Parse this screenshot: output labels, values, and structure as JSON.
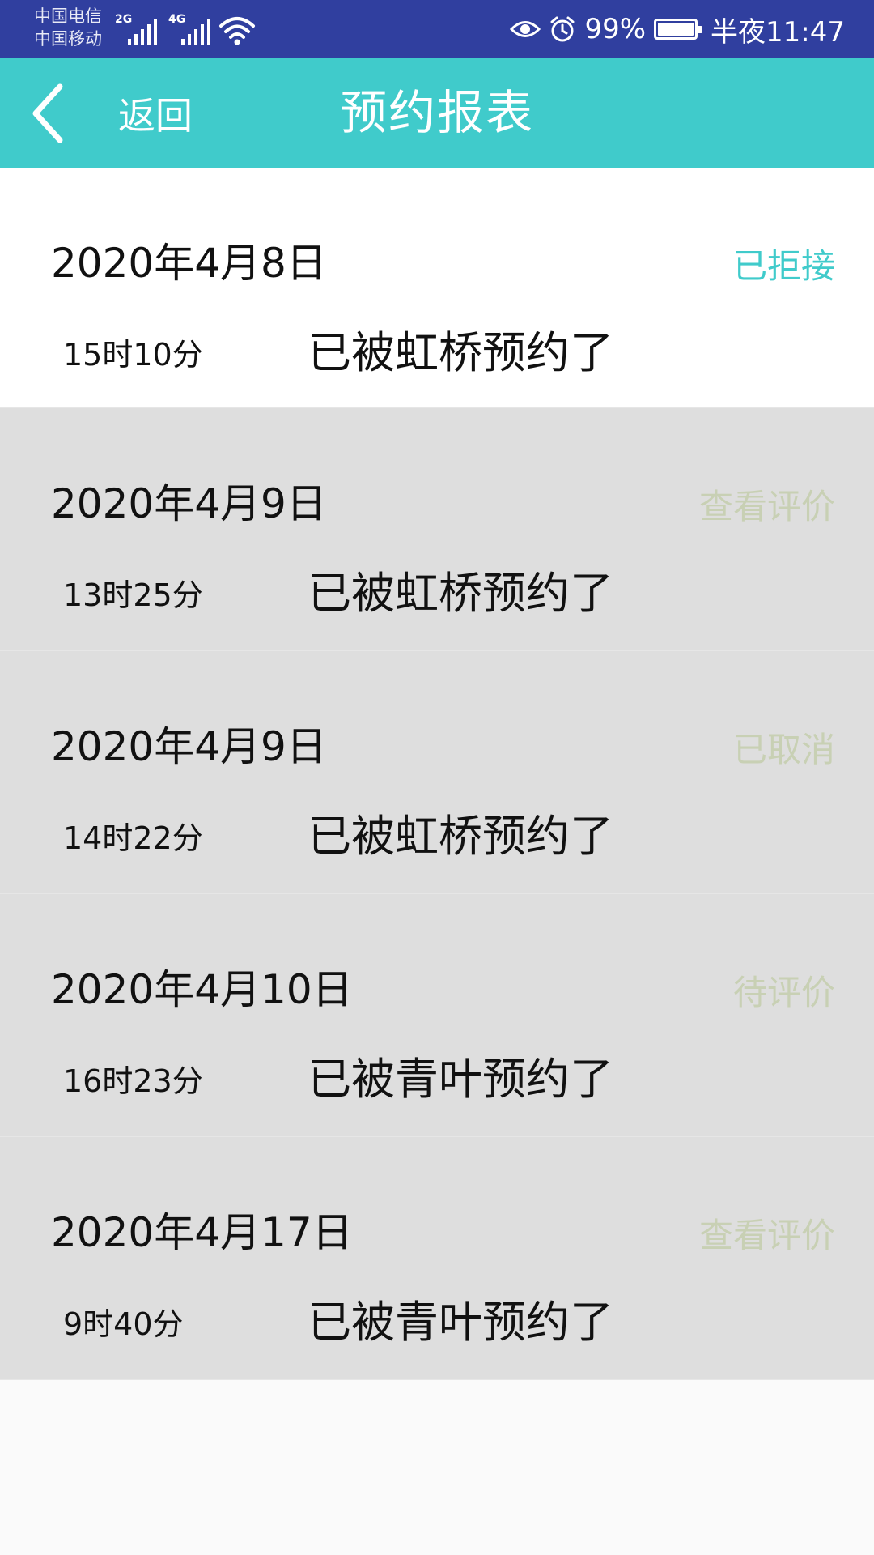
{
  "status_bar": {
    "carrier_1": "中国电信",
    "carrier_2": "中国移动",
    "net_1": "2G",
    "net_2": "4G",
    "battery": "99%",
    "battery_level": 0.99,
    "time": "半夜11:47",
    "icons": [
      "eye-icon",
      "alarm-icon",
      "battery-icon",
      "wifi-icon",
      "signal-icon"
    ]
  },
  "app_bar": {
    "back_label": "返回",
    "title": "预约报表"
  },
  "colors": {
    "status_bar": "#303f9f",
    "app_bar": "#40cbcb",
    "status_active": "#40cbcb",
    "status_muted": "#c8d0b4",
    "row_gray": "#dedede"
  },
  "records": [
    {
      "date": "2020年4月8日",
      "status": "已拒接",
      "time": "15时10分",
      "message": "已被虹桥预约了"
    },
    {
      "date": "2020年4月9日",
      "status": "查看评价",
      "time": "13时25分",
      "message": "已被虹桥预约了"
    },
    {
      "date": "2020年4月9日",
      "status": "已取消",
      "time": "14时22分",
      "message": "已被虹桥预约了"
    },
    {
      "date": "2020年4月10日",
      "status": "待评价",
      "time": "16时23分",
      "message": "已被青叶预约了"
    },
    {
      "date": "2020年4月17日",
      "status": "查看评价",
      "time": "9时40分",
      "message": "已被青叶预约了"
    }
  ]
}
